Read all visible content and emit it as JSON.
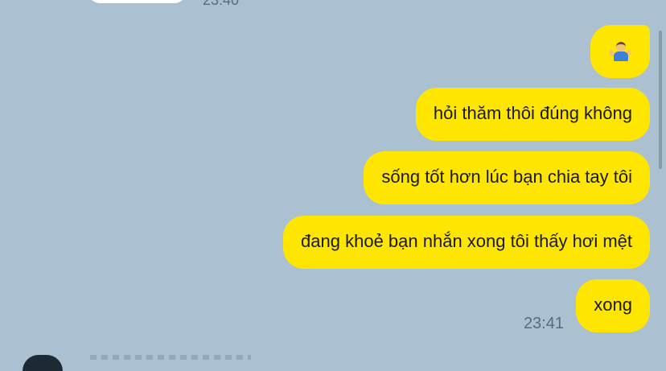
{
  "top_partial": {
    "time": "23:40"
  },
  "messages": [
    {
      "emoji": "person-shrugging",
      "text": ""
    },
    {
      "text": "hỏi thăm thôi đúng không"
    },
    {
      "text": "sống tốt hơn lúc bạn chia tay tôi"
    },
    {
      "text": "đang khoẻ bạn nhắn xong tôi thấy hơi mệt"
    },
    {
      "text": "xong"
    }
  ],
  "last_time": "23:41",
  "colors": {
    "background": "#abc1d1",
    "outgoing_bubble": "#ffe600",
    "incoming_bubble": "#ffffff",
    "timestamp": "#5d6b76"
  }
}
